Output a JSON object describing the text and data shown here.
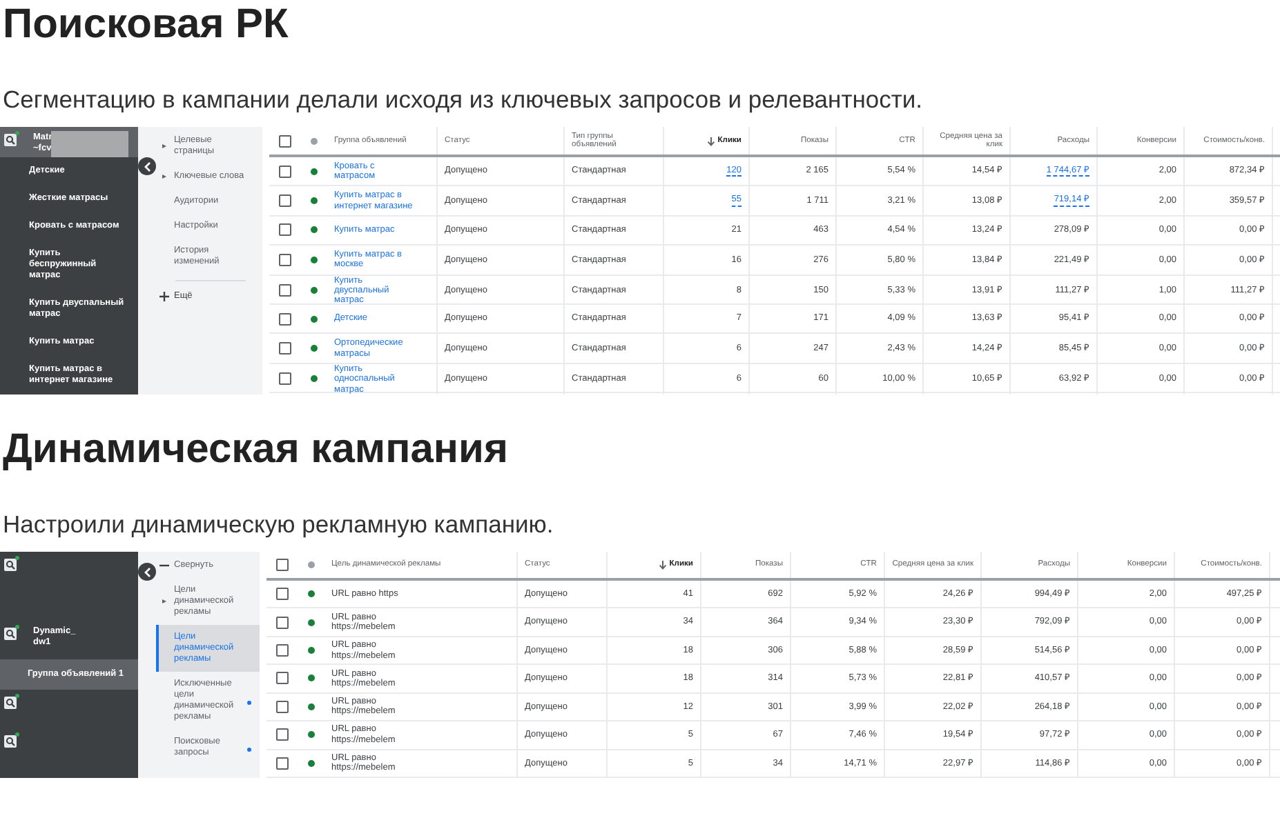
{
  "sections": [
    {
      "heading": "Поисковая РК",
      "text": "Сегментацию в кампании делали исходя из ключевых запросов и релевантности.",
      "screenshot": {
        "sidebar": [
          {
            "kind": "campaign",
            "lines": [
              "Matr",
              "~fcv"
            ],
            "redacted": true,
            "selected": true
          },
          {
            "kind": "group",
            "label": "Детские",
            "selected": false
          },
          {
            "kind": "group",
            "label": "Жесткие матрасы",
            "selected": false
          },
          {
            "kind": "group",
            "label": "Кровать с матрасом",
            "selected": false
          },
          {
            "kind": "group",
            "label": "Купить беспружинный матрас",
            "selected": false
          },
          {
            "kind": "group",
            "label": "Купить двуспальный матрас",
            "selected": false
          },
          {
            "kind": "group",
            "label": "Купить матрас",
            "selected": false
          },
          {
            "kind": "group",
            "label": "Купить матрас в интернет магазине",
            "selected": false
          }
        ],
        "nav": [
          {
            "kind": "section",
            "label": "Целевые страницы",
            "selected": false
          },
          {
            "kind": "section",
            "label": "Ключевые слова",
            "selected": false
          },
          {
            "kind": "page",
            "label": "Аудитории",
            "selected": false
          },
          {
            "kind": "page",
            "label": "Настройки",
            "selected": false
          },
          {
            "kind": "page",
            "label": "История изменений",
            "selected": false
          },
          {
            "kind": "more",
            "label": "Ещё",
            "selected": false
          }
        ],
        "select_all": {
          "checked": false
        },
        "columns": [
          {
            "label": "Группа объявлений",
            "kind": "link",
            "sorted": false
          },
          {
            "label": "Статус",
            "kind": "text",
            "sorted": false
          },
          {
            "label": "Тип группы объявлений",
            "kind": "text",
            "sorted": false
          },
          {
            "label": "Клики",
            "kind": "number",
            "sorted": true
          },
          {
            "label": "Показы",
            "kind": "number",
            "sorted": false
          },
          {
            "label": "CTR",
            "kind": "number",
            "sorted": false
          },
          {
            "label": "Средняя цена за клик",
            "kind": "number",
            "sorted": false
          },
          {
            "label": "Расходы",
            "kind": "number",
            "sorted": false
          },
          {
            "label": "Конверсии",
            "kind": "number",
            "sorted": false
          },
          {
            "label": "Стоимость/конв.",
            "kind": "number",
            "sorted": false
          }
        ],
        "rows": [
          {
            "checked": false,
            "cells": [
              "Кровать с матрасом",
              "Допущено",
              "Стандартная",
              {
                "text": "120",
                "link": true
              },
              "2 165",
              "5,54 %",
              "14,54 ₽",
              {
                "text": "1 744,67 ₽",
                "link": true
              },
              "2,00",
              "872,34 ₽"
            ]
          },
          {
            "checked": false,
            "cells": [
              "Купить матрас в интернет магазине",
              "Допущено",
              "Стандартная",
              {
                "text": "55",
                "link": true
              },
              "1 711",
              "3,21 %",
              "13,08 ₽",
              {
                "text": "719,14 ₽",
                "link": true
              },
              "2,00",
              "359,57 ₽"
            ]
          },
          {
            "checked": false,
            "cells": [
              "Купить матрас",
              "Допущено",
              "Стандартная",
              "21",
              "463",
              "4,54 %",
              "13,24 ₽",
              "278,09 ₽",
              "0,00",
              "0,00 ₽"
            ]
          },
          {
            "checked": false,
            "cells": [
              "Купить матрас в москве",
              "Допущено",
              "Стандартная",
              "16",
              "276",
              "5,80 %",
              "13,84 ₽",
              "221,49 ₽",
              "0,00",
              "0,00 ₽"
            ]
          },
          {
            "checked": false,
            "cells": [
              "Купить двуспальный матрас",
              "Допущено",
              "Стандартная",
              "8",
              "150",
              "5,33 %",
              "13,91 ₽",
              "111,27 ₽",
              "1,00",
              "111,27 ₽"
            ]
          },
          {
            "checked": false,
            "cells": [
              "Детские",
              "Допущено",
              "Стандартная",
              "7",
              "171",
              "4,09 %",
              "13,63 ₽",
              "95,41 ₽",
              "0,00",
              "0,00 ₽"
            ]
          },
          {
            "checked": false,
            "cells": [
              "Ортопедические матрасы",
              "Допущено",
              "Стандартная",
              "6",
              "247",
              "2,43 %",
              "14,24 ₽",
              "85,45 ₽",
              "0,00",
              "0,00 ₽"
            ]
          },
          {
            "checked": false,
            "cells": [
              "Купить односпальный матрас",
              "Допущено",
              "Стандартная",
              "6",
              "60",
              "10,00 %",
              "10,65 ₽",
              "63,92 ₽",
              "0,00",
              "0,00 ₽"
            ]
          }
        ]
      }
    },
    {
      "heading": "Динамическая кампания",
      "text": "Настроили динамическую рекламную кампанию.",
      "screenshot": {
        "sidebar": [
          {
            "kind": "campaign",
            "selected": false
          },
          {
            "kind": "spacer"
          },
          {
            "kind": "campaign",
            "lines": [
              "Dynamic_",
              "dw1"
            ],
            "selected": false
          },
          {
            "kind": "group",
            "label": "Группа объявлений 1",
            "selected": true
          },
          {
            "kind": "campaign",
            "selected": false
          },
          {
            "kind": "campaign",
            "selected": false
          }
        ],
        "nav": [
          {
            "kind": "collapse",
            "label": "Свернуть",
            "selected": false,
            "dot": false
          },
          {
            "kind": "section",
            "label": "Цели динамической рекламы",
            "selected": false,
            "dot": false
          },
          {
            "kind": "page",
            "label": "Цели динамической рекламы",
            "selected": true,
            "dot": false
          },
          {
            "kind": "page",
            "label": "Исключенные цели динамической рекламы",
            "selected": false,
            "dot": true
          },
          {
            "kind": "page",
            "label": "Поисковые запросы",
            "selected": false,
            "dot": true
          }
        ],
        "select_all": {
          "checked": false
        },
        "columns": [
          {
            "label": "Цель динамической рекламы",
            "kind": "text",
            "sorted": false
          },
          {
            "label": "Статус",
            "kind": "text",
            "sorted": false
          },
          {
            "label": "Клики",
            "kind": "number",
            "sorted": true
          },
          {
            "label": "Показы",
            "kind": "number",
            "sorted": false
          },
          {
            "label": "CTR",
            "kind": "number",
            "sorted": false
          },
          {
            "label": "Средняя цена за клик",
            "kind": "number",
            "sorted": false
          },
          {
            "label": "Расходы",
            "kind": "number",
            "sorted": false
          },
          {
            "label": "Конверсии",
            "kind": "number",
            "sorted": false
          },
          {
            "label": "Стоимость/конв.",
            "kind": "number",
            "sorted": false
          }
        ],
        "rows": [
          {
            "checked": false,
            "cells": [
              "URL равно https",
              "Допущено",
              "41",
              "692",
              "5,92 %",
              "24,26 ₽",
              "994,49 ₽",
              "2,00",
              "497,25 ₽"
            ]
          },
          {
            "checked": false,
            "cells": [
              "URL равно\nhttps://mebelem",
              "Допущено",
              "34",
              "364",
              "9,34 %",
              "23,30 ₽",
              "792,09 ₽",
              "0,00",
              "0,00 ₽"
            ]
          },
          {
            "checked": false,
            "cells": [
              "URL равно\nhttps://mebelem",
              "Допущено",
              "18",
              "306",
              "5,88 %",
              "28,59 ₽",
              "514,56 ₽",
              "0,00",
              "0,00 ₽"
            ]
          },
          {
            "checked": false,
            "cells": [
              "URL равно\nhttps://mebelem",
              "Допущено",
              "18",
              "314",
              "5,73 %",
              "22,81 ₽",
              "410,57 ₽",
              "0,00",
              "0,00 ₽"
            ]
          },
          {
            "checked": false,
            "cells": [
              "URL равно\nhttps://mebelem",
              "Допущено",
              "12",
              "301",
              "3,99 %",
              "22,02 ₽",
              "264,18 ₽",
              "0,00",
              "0,00 ₽"
            ]
          },
          {
            "checked": false,
            "cells": [
              "URL равно\nhttps://mebelem",
              "Допущено",
              "5",
              "67",
              "7,46 %",
              "19,54 ₽",
              "97,72 ₽",
              "0,00",
              "0,00 ₽"
            ]
          },
          {
            "checked": false,
            "cells": [
              "URL равно\nhttps://mebelem",
              "Допущено",
              "5",
              "34",
              "14,71 %",
              "22,97 ₽",
              "114,86 ₽",
              "0,00",
              "0,00 ₽"
            ]
          }
        ]
      }
    }
  ]
}
